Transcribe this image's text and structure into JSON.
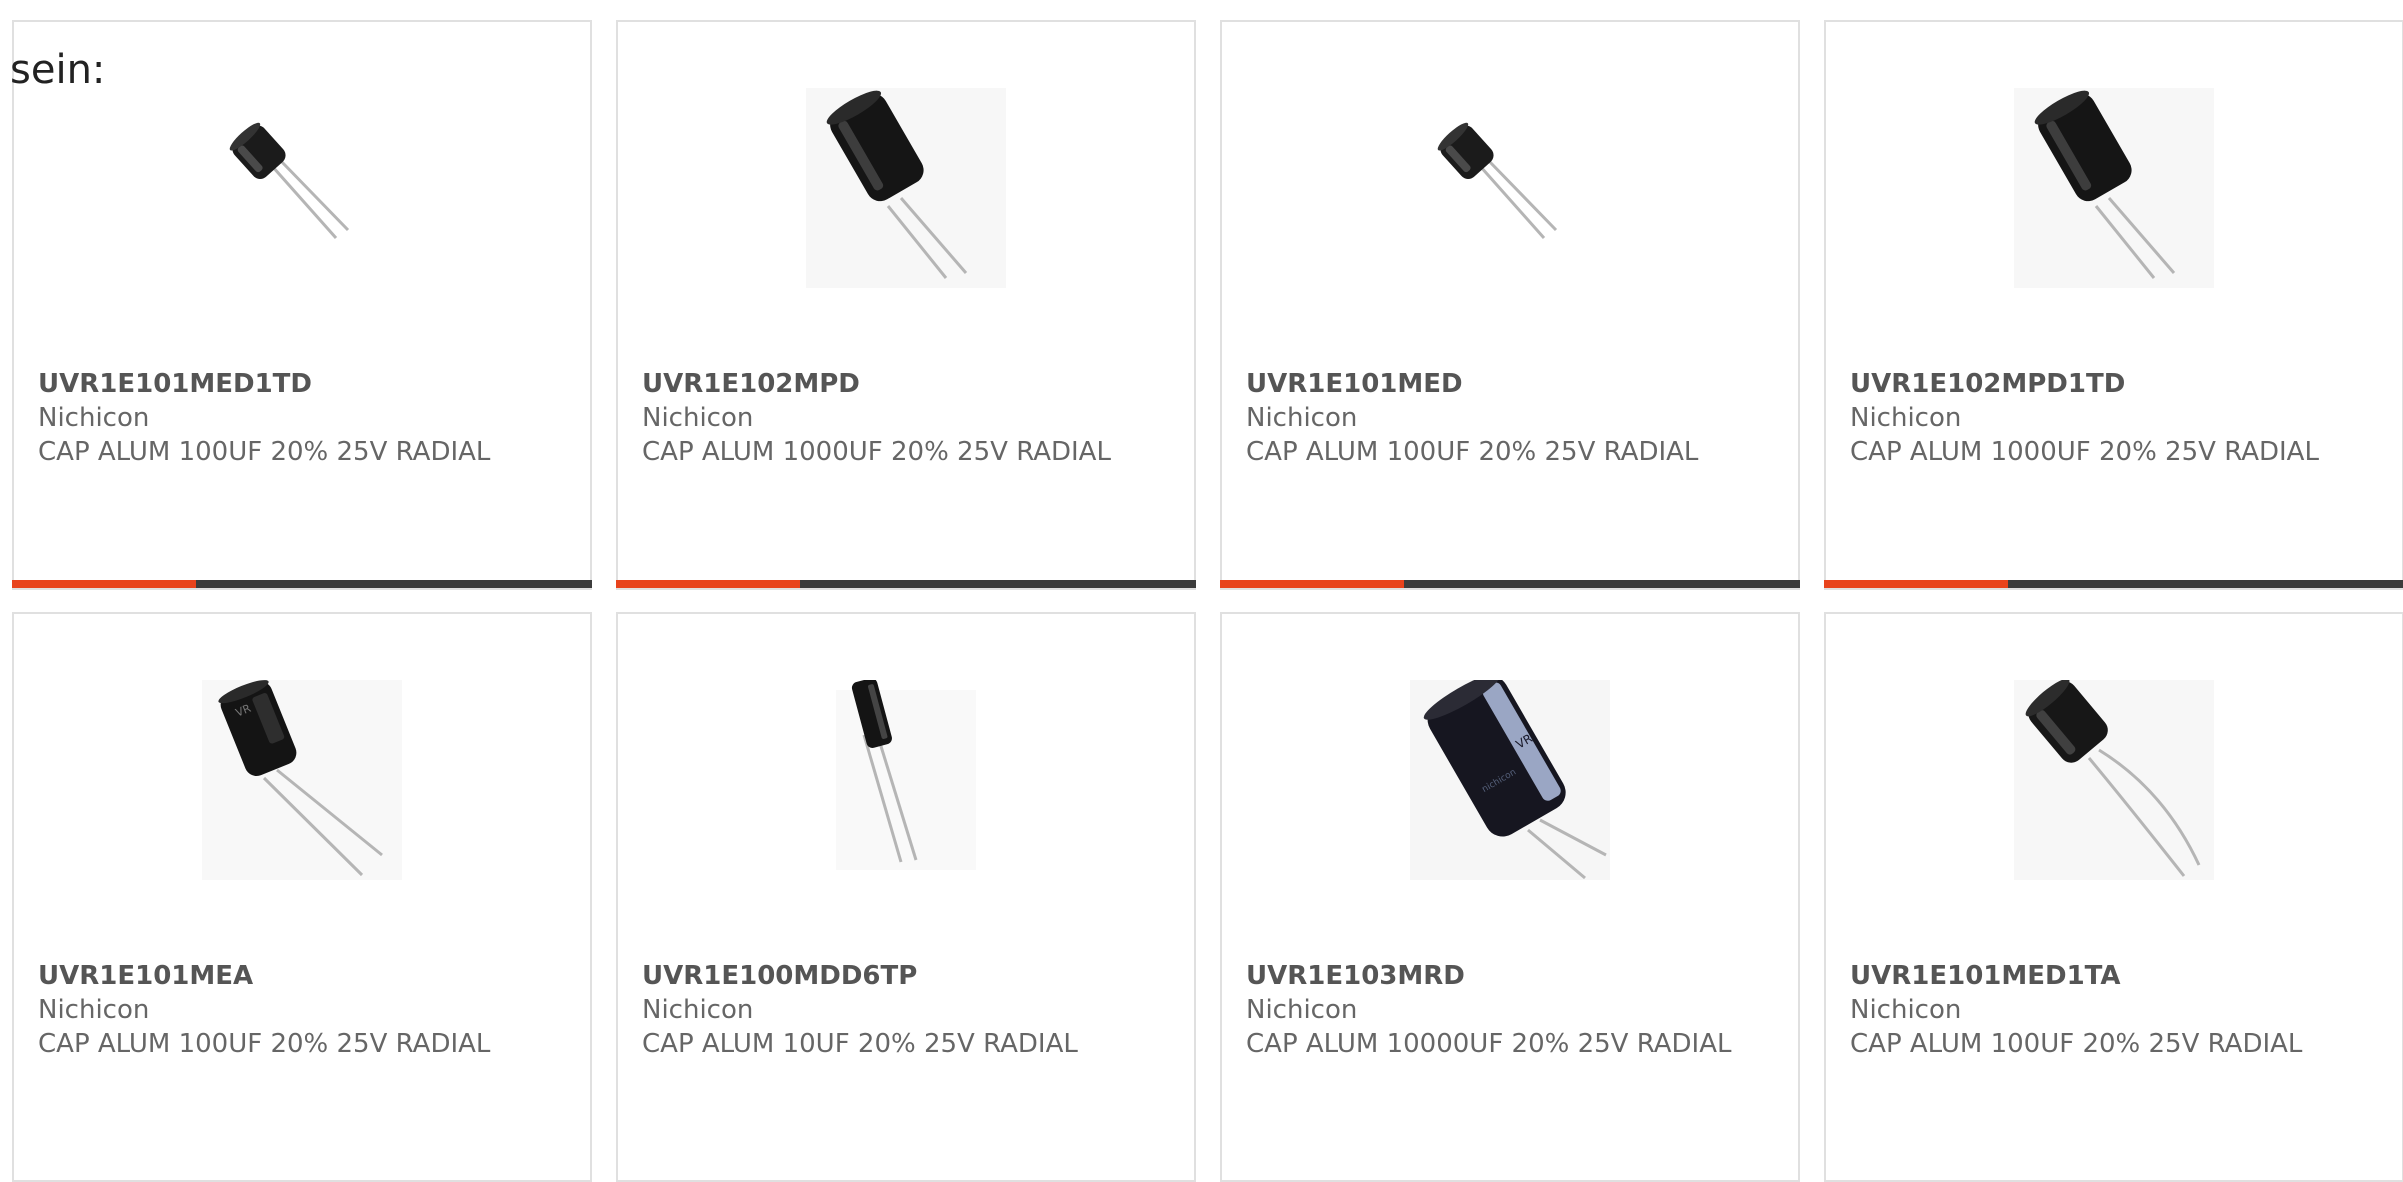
{
  "intro_text": "sein:",
  "colors": {
    "accent": "#e8431c",
    "bar": "#3c3c3c",
    "border": "#e0e0e0",
    "text": "#666666"
  },
  "products": [
    {
      "part_number": "UVR1E101MED1TD",
      "manufacturer": "Nichicon",
      "description": "CAP ALUM 100UF 20% 25V RADIAL",
      "image_icon": "radial-capacitor-small-icon",
      "active": true
    },
    {
      "part_number": "UVR1E102MPD",
      "manufacturer": "Nichicon",
      "description": "CAP ALUM 1000UF 20% 25V RADIAL",
      "image_icon": "radial-capacitor-large-icon",
      "active": true
    },
    {
      "part_number": "UVR1E101MED",
      "manufacturer": "Nichicon",
      "description": "CAP ALUM 100UF 20% 25V RADIAL",
      "image_icon": "radial-capacitor-small-icon",
      "active": true
    },
    {
      "part_number": "UVR1E102MPD1TD",
      "manufacturer": "Nichicon",
      "description": "CAP ALUM 1000UF 20% 25V RADIAL",
      "image_icon": "radial-capacitor-large-icon",
      "active": true
    },
    {
      "part_number": "UVR1E101MEA",
      "manufacturer": "Nichicon",
      "description": "CAP ALUM 100UF 20% 25V RADIAL",
      "image_icon": "radial-capacitor-medium-icon",
      "active": false
    },
    {
      "part_number": "UVR1E100MDD6TP",
      "manufacturer": "Nichicon",
      "description": "CAP ALUM 10UF 20% 25V RADIAL",
      "image_icon": "radial-capacitor-slim-icon",
      "active": false
    },
    {
      "part_number": "UVR1E103MRD",
      "manufacturer": "Nichicon",
      "description": "CAP ALUM 10000UF 20% 25V RADIAL",
      "image_icon": "radial-capacitor-xl-icon",
      "active": false
    },
    {
      "part_number": "UVR1E101MED1TA",
      "manufacturer": "Nichicon",
      "description": "CAP ALUM 100UF 20% 25V RADIAL",
      "image_icon": "radial-capacitor-bent-icon",
      "active": false
    }
  ]
}
